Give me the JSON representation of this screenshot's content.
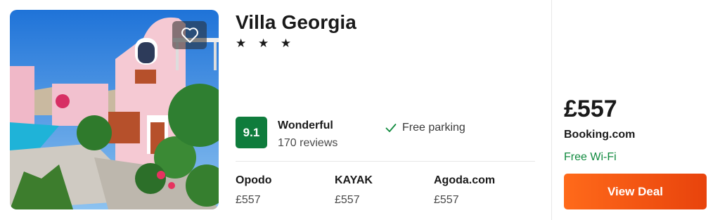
{
  "hotel": {
    "name": "Villa Georgia",
    "stars": "★ ★ ★",
    "rating_score": "9.1",
    "rating_word": "Wonderful",
    "reviews": "170 reviews",
    "amenity": "Free parking"
  },
  "providers": [
    {
      "name": "Opodo",
      "price": "£557"
    },
    {
      "name": "KAYAK",
      "price": "£557"
    },
    {
      "name": "Agoda.com",
      "price": "£557"
    }
  ],
  "deal": {
    "price": "£557",
    "provider": "Booking.com",
    "amenity": "Free Wi-Fi",
    "button_label": "View Deal"
  },
  "icons": {
    "favorite": "heart-icon",
    "amenity_check": "check-icon"
  },
  "colors": {
    "rating_badge": "#0f7c3c",
    "deal_button": "#ff6a1a",
    "free_wifi": "#108a3e"
  }
}
